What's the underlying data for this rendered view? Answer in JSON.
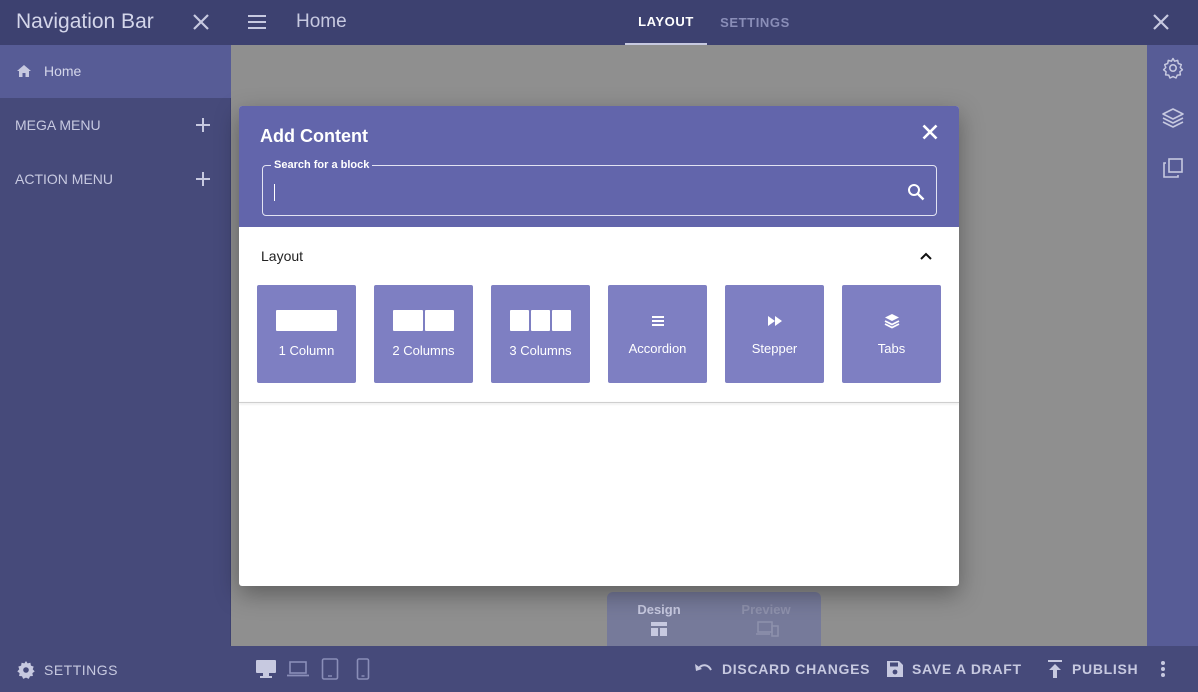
{
  "nav_panel": {
    "title": "Navigation Bar",
    "home_label": "Home",
    "sections": [
      {
        "label": "MEGA MENU"
      },
      {
        "label": "ACTION MENU"
      }
    ]
  },
  "topbar": {
    "page_title": "Home",
    "tabs": [
      {
        "label": "LAYOUT",
        "active": true
      },
      {
        "label": "SETTINGS",
        "active": false
      }
    ]
  },
  "right_toolbar": {
    "icons": [
      "gear-icon",
      "layers-icon",
      "copy-icon"
    ]
  },
  "bottom_bar": {
    "settings_label": "SETTINGS",
    "devices": [
      "desktop-icon",
      "laptop-icon",
      "tablet-icon",
      "phone-icon"
    ],
    "discard_label": "DISCARD CHANGES",
    "save_draft_label": "SAVE A DRAFT",
    "publish_label": "PUBLISH"
  },
  "mode_switch": {
    "design_label": "Design",
    "preview_label": "Preview",
    "active": "Design"
  },
  "modal": {
    "title": "Add Content",
    "search": {
      "label": "Search for a block",
      "value": "",
      "placeholder": ""
    },
    "section": {
      "label": "Layout",
      "expanded": true,
      "blocks": [
        {
          "label": "1 Column",
          "icon": "one-column-icon"
        },
        {
          "label": "2 Columns",
          "icon": "two-columns-icon"
        },
        {
          "label": "3 Columns",
          "icon": "three-columns-icon"
        },
        {
          "label": "Accordion",
          "icon": "accordion-icon"
        },
        {
          "label": "Stepper",
          "icon": "stepper-icon"
        },
        {
          "label": "Tabs",
          "icon": "tabs-icon"
        }
      ]
    }
  },
  "colors": {
    "panel": "#464a7a",
    "bar": "#3d4170",
    "accent": "#6265ab",
    "tile": "#7e7fc2",
    "active_item": "#575c96"
  }
}
